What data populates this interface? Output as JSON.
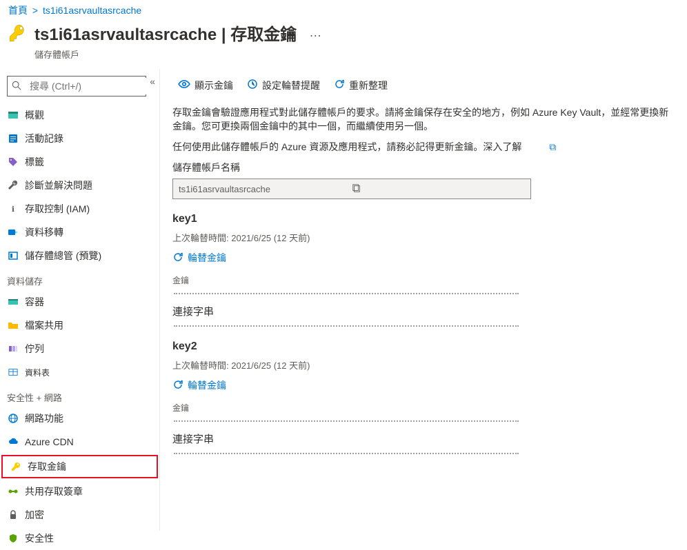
{
  "breadcrumb": {
    "home": "首頁",
    "current": "ts1i61asrvaultasrcache"
  },
  "header": {
    "title": "ts1i61asrvaultasrcache | 存取金鑰",
    "subtitle": "儲存體帳戶",
    "more": "…"
  },
  "search": {
    "placeholder": "搜尋 (Ctrl+/)"
  },
  "nav": {
    "overview": "概觀",
    "activity_log": "活動記錄",
    "tags": "標籤",
    "diagnose": "診斷並解決問題",
    "iam": "存取控制 (IAM)",
    "data_migration": "資料移轉",
    "storage_explorer": "儲存體總管 (預覽)",
    "section_data": "資料儲存",
    "containers": "容器",
    "file_shares": "檔案共用",
    "queues": "佇列",
    "tables": "資料表",
    "section_security": "安全性 + 網路",
    "networking": "網路功能",
    "cdn": "Azure CDN",
    "access_keys": "存取金鑰",
    "sas": "共用存取簽章",
    "encryption": "加密",
    "security": "安全性"
  },
  "cmd": {
    "show_keys": "顯示金鑰",
    "set_reminder": "設定輪替提醒",
    "refresh": "重新整理"
  },
  "desc": {
    "p1": "存取金鑰會驗證應用程式對此儲存體帳戶的要求。請將金鑰保存在安全的地方，例如 Azure Key Vault，並經常更換新金鑰。您可更換兩個金鑰中的其中一個，而繼續使用另一個。",
    "p2": "任何使用此儲存體帳戶的 Azure 資源及應用程式，請務必記得更新金鑰。深入了解"
  },
  "account_name": {
    "label": "儲存體帳戶名稱",
    "value": "ts1i61asrvaultasrcache"
  },
  "key1": {
    "name": "key1",
    "last_rotated_label": "上次輪替時間:",
    "last_rotated_value": "2021/6/25 (12 天前)",
    "rotate": "輪替金鑰",
    "key_label": "金鑰",
    "conn_label": "連接字串"
  },
  "key2": {
    "name": "key2",
    "last_rotated_label": "上次輪替時間:",
    "last_rotated_value": "2021/6/25 (12 天前)",
    "rotate": "輪替金鑰",
    "key_label": "金鑰",
    "conn_label": "連接字串"
  }
}
